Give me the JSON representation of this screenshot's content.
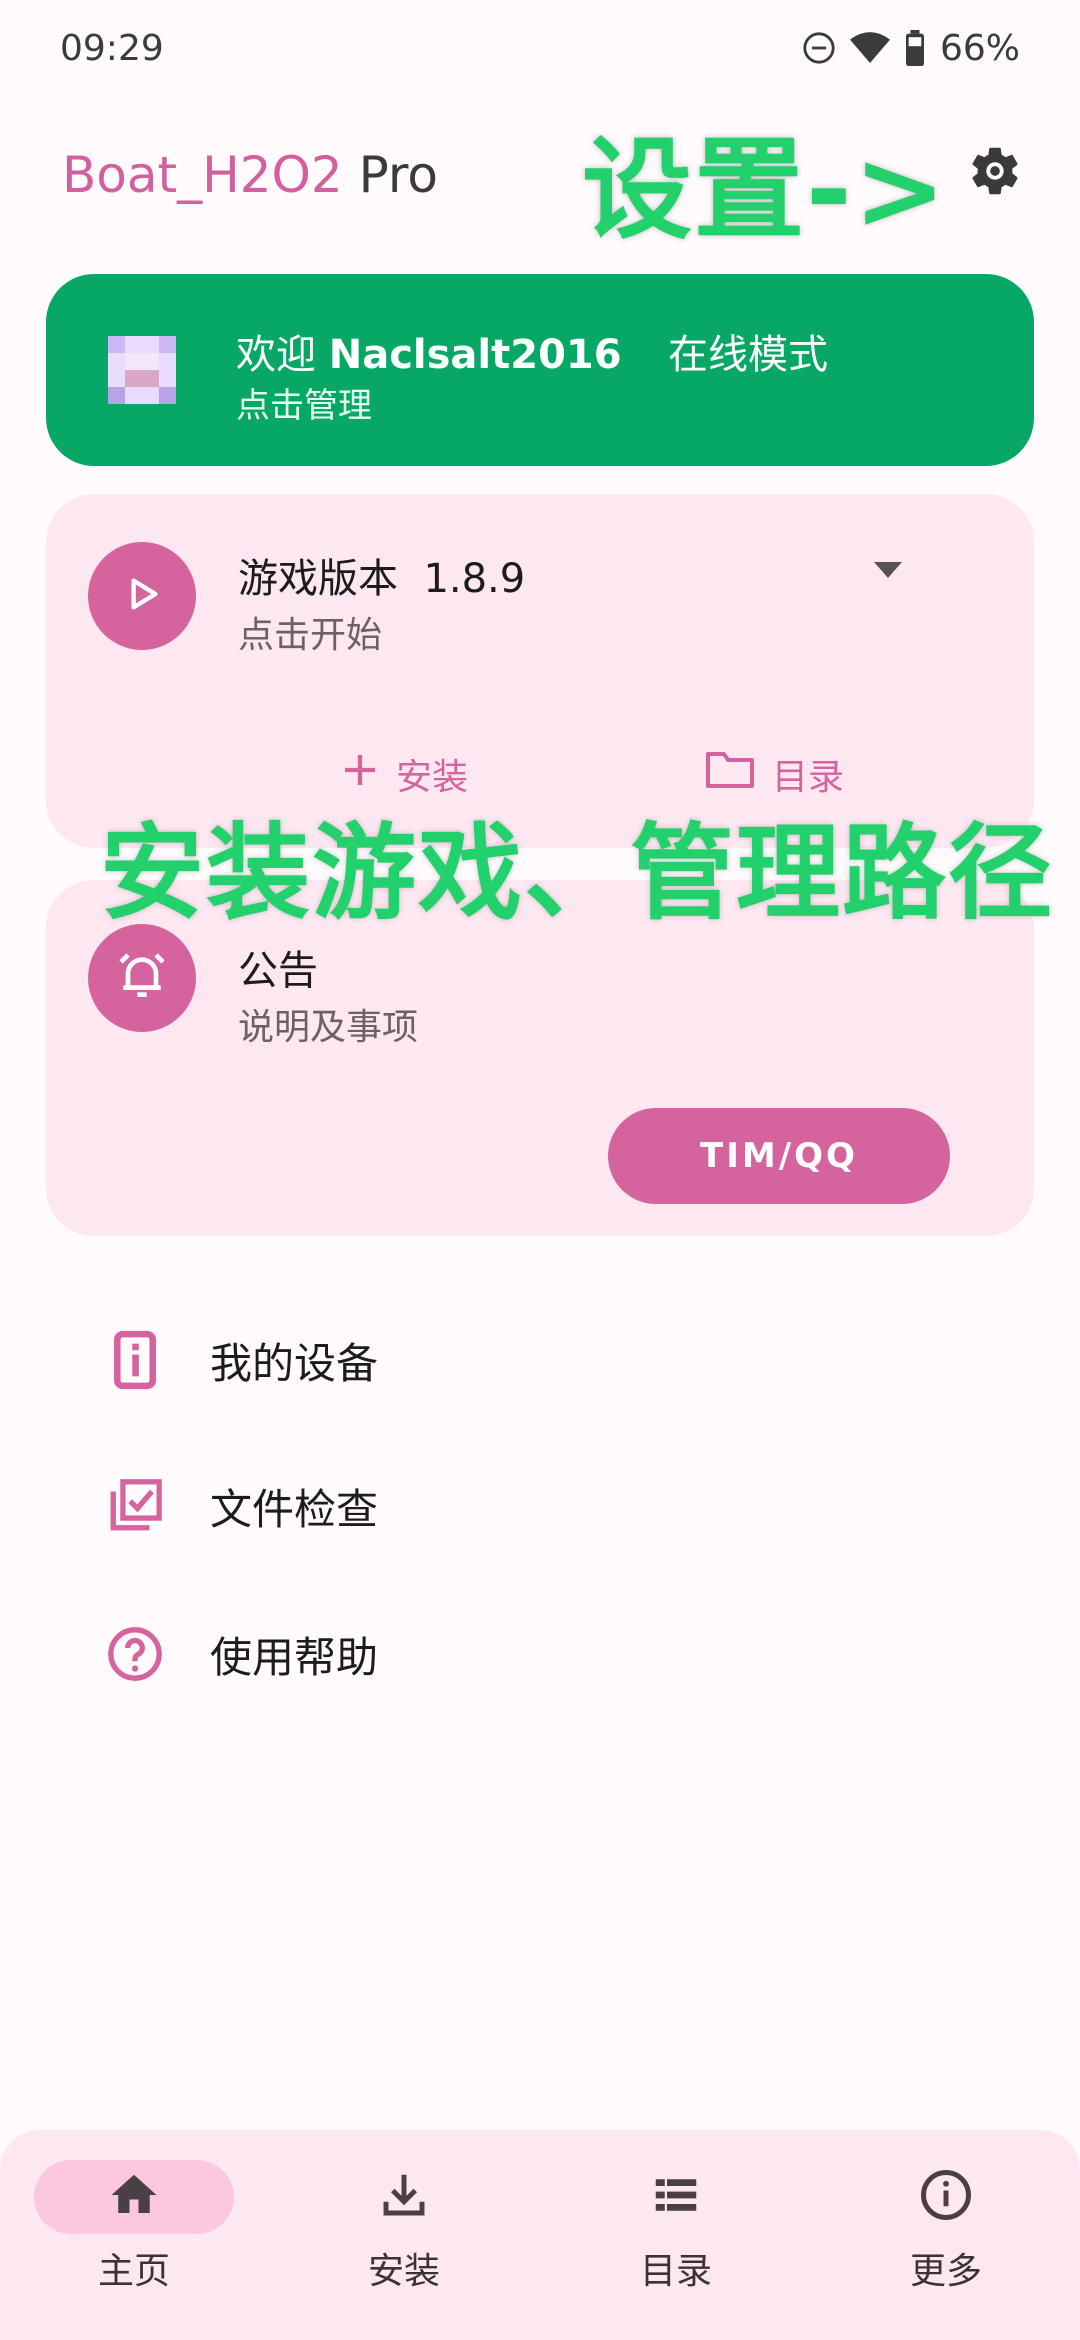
{
  "status_bar": {
    "time": "09:29",
    "battery": "66%"
  },
  "app_bar": {
    "title_brand": "Boat_H2O2",
    "title_suffix": " Pro",
    "overlay_annotation": "设置->"
  },
  "account": {
    "welcome_prefix": "欢迎 ",
    "username": "Naclsalt2016",
    "mode": "在线模式",
    "subtitle": "点击管理"
  },
  "game_card": {
    "title": "游戏版本",
    "version": "1.8.9",
    "subtitle": "点击开始",
    "install_label": "安装",
    "directory_label": "目录"
  },
  "overlay_annotation_2": "安装游戏、管理路径",
  "notice_card": {
    "title": "公告",
    "subtitle": "说明及事项",
    "button_label": "TIM/QQ"
  },
  "menu": [
    {
      "label": "我的设备",
      "icon": "device-info-icon"
    },
    {
      "label": "文件检查",
      "icon": "file-check-icon"
    },
    {
      "label": "使用帮助",
      "icon": "help-icon"
    }
  ],
  "bottom_nav": [
    {
      "label": "主页",
      "icon": "home-icon",
      "active": true
    },
    {
      "label": "安装",
      "icon": "download-icon",
      "active": false
    },
    {
      "label": "目录",
      "icon": "list-icon",
      "active": false
    },
    {
      "label": "更多",
      "icon": "info-icon",
      "active": false
    }
  ],
  "colors": {
    "accent": "#d5649e",
    "account_card": "#07a866",
    "card_bg": "#fde7f1",
    "annotation": "#22d06c"
  }
}
